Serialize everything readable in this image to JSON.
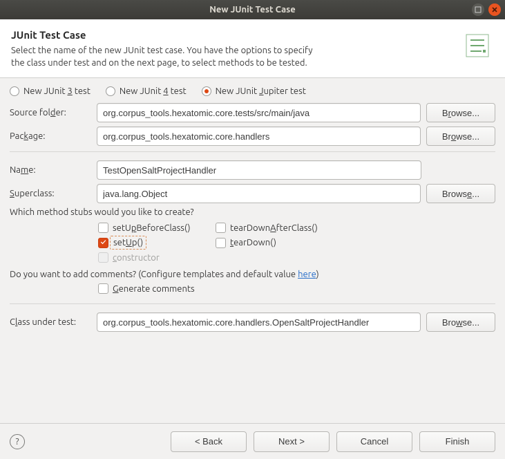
{
  "window": {
    "title": "New JUnit Test Case"
  },
  "header": {
    "title": "JUnit Test Case",
    "desc1": "Select the name of the new JUnit test case. You have the options to specify",
    "desc2": "the class under test and on the next page, to select methods to be tested."
  },
  "radios": {
    "junit3": {
      "pre": "New JUnit ",
      "u": "3",
      "post": " test",
      "selected": false
    },
    "junit4": {
      "pre": "New JUnit ",
      "u": "4",
      "post": " test",
      "selected": false
    },
    "jupiter": {
      "pre": "New JUnit ",
      "u": "J",
      "post": "upiter test",
      "selected": true
    }
  },
  "fields": {
    "sourceFolder": {
      "label_pre": "Source fol",
      "label_u": "d",
      "label_post": "er:",
      "value": "org.corpus_tools.hexatomic.core.tests/src/main/java",
      "browse": "Browse..."
    },
    "package": {
      "label_pre": "Pac",
      "label_u": "k",
      "label_post": "age:",
      "value": "org.corpus_tools.hexatomic.core.handlers",
      "browse": "Browse..."
    },
    "name": {
      "label_pre": "Na",
      "label_u": "m",
      "label_post": "e:",
      "value": "TestOpenSaltProjectHandler"
    },
    "superclass": {
      "label_u": "S",
      "label_post": "uperclass:",
      "value": "java.lang.Object",
      "browse_pre": "Brows",
      "browse_u": "e",
      "browse_post": "..."
    },
    "classUnderTest": {
      "label_pre": "C",
      "label_u": "l",
      "label_post": "ass under test:",
      "value": "org.corpus_tools.hexatomic.core.handlers.OpenSaltProjectHandler",
      "browse": "Browse..."
    }
  },
  "stubs": {
    "question": "Which method stubs would you like to create?",
    "setUpBeforeClass": {
      "pre": "setU",
      "u": "p",
      "post": "BeforeClass()",
      "checked": false
    },
    "tearDownAfterClass": {
      "pre": "tearDown",
      "u": "A",
      "post": "fterClass()",
      "checked": false
    },
    "setUp": {
      "pre": "set",
      "u": "U",
      "post": "p()",
      "checked": true
    },
    "tearDown": {
      "u": "t",
      "post": "earDown()",
      "checked": false
    },
    "constructor": {
      "u": "c",
      "post": "onstructor",
      "checked": false,
      "disabled": true
    }
  },
  "comments": {
    "question_pre": "Do you want to add comments? (Configure templates and default value ",
    "link": "here",
    "question_post": ")",
    "generate": {
      "u": "G",
      "post": "enerate comments",
      "checked": false
    }
  },
  "footer": {
    "back": "< Back",
    "next": "Next >",
    "cancel": "Cancel",
    "finish": "Finish"
  }
}
